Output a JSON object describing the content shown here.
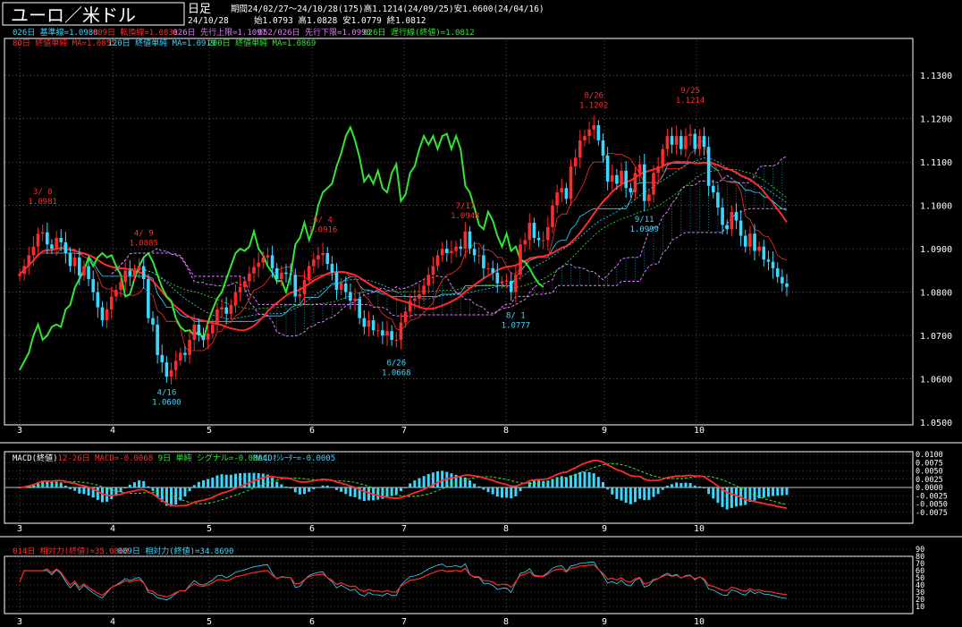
{
  "header": {
    "pair_title": "ユーロ／米ドル",
    "period_label": "日足",
    "period_summary": "期間24/02/27～24/10/28(175)高1.1214(24/09/25)安1.0600(24/04/16)",
    "date": "24/10/28",
    "ohlc": "始1.0793 高1.0828 安1.0779 終1.0812",
    "ichimoku_line1": [
      {
        "text": "026日 基準線=1.0988",
        "color": "#3ad7ff"
      },
      {
        "text": "009日 転換線=1.0831",
        "color": "#ff2a2a"
      },
      {
        "text": "026日 先行上限=1.1097",
        "color": "#e07bff"
      },
      {
        "text": "052/026日 先行下限=1.0990",
        "color": "#e07bff"
      },
      {
        "text": "026日 遅行線(終値)=1.0812",
        "color": "#32e632"
      }
    ],
    "ma_line": [
      {
        "text": "80日 終値単純 MA=1.0855",
        "color": "#ff2a2a"
      },
      {
        "text": "120日 終値単純 MA=1.0919",
        "color": "#3ad7ff"
      },
      {
        "text": "200日 終値単純 MA=1.0869",
        "color": "#32e632"
      }
    ]
  },
  "macd_header": [
    {
      "text": "MACD(終値)",
      "color": "#ffffff"
    },
    {
      "text": "12-26日 MACD=-0.0068",
      "color": "#ff2a2a"
    },
    {
      "text": "9日 単純 シグナル=-0.0064",
      "color": "#32e632"
    },
    {
      "text": "MACDｵｼﾚｰﾀｰ=-0.0005",
      "color": "#3ad7ff"
    }
  ],
  "rsi_header": [
    {
      "text": "014日 相対力(終値)=35.0868",
      "color": "#ff2a2a"
    },
    {
      "text": "009日 相対力(終値)=34.8690",
      "color": "#3ad7ff"
    }
  ],
  "x_ticks": [
    "3",
    "4",
    "5",
    "6",
    "7",
    "8",
    "9",
    "10"
  ],
  "chart_data": [
    {
      "type": "candlestick",
      "ylim": [
        1.05,
        1.135
      ],
      "y_ticks": [
        "1.0500",
        "1.0600",
        "1.0700",
        "1.0800",
        "1.0900",
        "1.1000",
        "1.1100",
        "1.1200",
        "1.1300"
      ],
      "colors": {
        "up": "#ff2a2a",
        "down": "#3ad7ff",
        "ma80": "#ff2a2a",
        "ma120": "#3ad7ff",
        "ma200": "#32e632",
        "cloud": "#e07bff",
        "lagging": "#32e632"
      },
      "annotations": [
        {
          "date": "3/ 8",
          "value": "1.0981",
          "index": 5,
          "price": 1.0981,
          "pos": "above",
          "color": "#ff2a2a"
        },
        {
          "date": "4/ 9",
          "value": "1.0885",
          "index": 27,
          "price": 1.0885,
          "pos": "above",
          "color": "#ff2a2a"
        },
        {
          "date": "4/16",
          "value": "1.0600",
          "index": 32,
          "price": 1.06,
          "pos": "below",
          "color": "#3ad7ff"
        },
        {
          "date": "6/ 4",
          "value": "1.0916",
          "index": 66,
          "price": 1.0916,
          "pos": "above",
          "color": "#ff2a2a"
        },
        {
          "date": "6/26",
          "value": "1.0668",
          "index": 82,
          "price": 1.0668,
          "pos": "below",
          "color": "#3ad7ff"
        },
        {
          "date": "7/17",
          "value": "1.0948",
          "index": 97,
          "price": 1.0948,
          "pos": "above",
          "color": "#ff2a2a"
        },
        {
          "date": "8/ 1",
          "value": "1.0777",
          "index": 108,
          "price": 1.0777,
          "pos": "below",
          "color": "#3ad7ff"
        },
        {
          "date": "8/26",
          "value": "1.1202",
          "index": 125,
          "price": 1.1202,
          "pos": "above",
          "color": "#ff2a2a"
        },
        {
          "date": "9/11",
          "value": "1.0999",
          "index": 136,
          "price": 1.0999,
          "pos": "below",
          "color": "#3ad7ff"
        },
        {
          "date": "9/25",
          "value": "1.1214",
          "index": 146,
          "price": 1.1214,
          "pos": "above",
          "color": "#ff2a2a"
        }
      ],
      "closes": [
        1.0842,
        1.086,
        1.0885,
        1.0905,
        1.0935,
        1.0938,
        1.091,
        1.09,
        1.0925,
        1.0915,
        1.089,
        1.086,
        1.088,
        1.0838,
        1.086,
        1.083,
        1.08,
        1.0765,
        1.0735,
        1.076,
        1.079,
        1.0805,
        1.0823,
        1.085,
        1.0838,
        1.085,
        1.086,
        1.083,
        1.074,
        1.0725,
        1.0655,
        1.0638,
        1.0605,
        1.062,
        1.0642,
        1.066,
        1.0655,
        1.069,
        1.0725,
        1.07,
        1.069,
        1.0705,
        1.0725,
        1.076,
        1.0765,
        1.075,
        1.077,
        1.08,
        1.0812,
        1.0825,
        1.0843,
        1.0858,
        1.0868,
        1.088,
        1.0885,
        1.0855,
        1.083,
        1.0845,
        1.0842,
        1.084,
        1.079,
        1.0795,
        1.0828,
        1.086,
        1.0875,
        1.0885,
        1.089,
        1.0865,
        1.0845,
        1.0805,
        1.082,
        1.08,
        1.078,
        1.0785,
        1.074,
        1.072,
        1.0735,
        1.0712,
        1.0712,
        1.07,
        1.071,
        1.069,
        1.069,
        1.073,
        1.0755,
        1.078,
        1.0785,
        1.0795,
        1.0815,
        1.084,
        1.086,
        1.0885,
        1.09,
        1.089,
        1.0895,
        1.0905,
        1.09,
        1.094,
        1.09,
        1.0885,
        1.0885,
        1.0855,
        1.0855,
        1.0845,
        1.082,
        1.0825,
        1.0826,
        1.08,
        1.084,
        1.091,
        1.092,
        1.096,
        1.0925,
        1.092,
        1.092,
        1.095,
        1.1,
        1.103,
        1.104,
        1.1015,
        1.109,
        1.111,
        1.115,
        1.116,
        1.1175,
        1.1185,
        1.115,
        1.1115,
        1.1055,
        1.107,
        1.105,
        1.108,
        1.104,
        1.103,
        1.1075,
        1.1095,
        1.101,
        1.1025,
        1.1075,
        1.109,
        1.113,
        1.116,
        1.114,
        1.116,
        1.113,
        1.116,
        1.1165,
        1.113,
        1.116,
        1.1135,
        1.1045,
        1.103,
        1.0995,
        1.0955,
        1.0945,
        1.0985,
        1.0965,
        1.093,
        1.0905,
        1.0935,
        1.0895,
        1.0905,
        1.0875,
        1.087,
        1.0855,
        1.0835,
        1.082,
        1.0812
      ],
      "lagging_span": [
        1.062,
        1.064,
        1.066,
        1.07,
        1.0725,
        1.069,
        1.07,
        1.072,
        1.0725,
        1.072,
        1.076,
        1.077,
        1.081,
        1.083,
        1.085,
        1.088,
        1.086,
        1.088,
        1.089,
        1.088,
        1.0885,
        1.086,
        1.084,
        1.079,
        1.0795,
        1.083,
        1.086,
        1.088,
        1.089,
        1.087,
        1.084,
        1.081,
        1.079,
        1.078,
        1.074,
        1.072,
        1.071,
        1.0712,
        1.07,
        1.071,
        1.069,
        1.073,
        1.076,
        1.0785,
        1.08,
        1.083,
        1.086,
        1.089,
        1.09,
        1.0895,
        1.0905,
        1.094,
        1.09,
        1.0885,
        1.086,
        1.0845,
        1.0825,
        1.0826,
        1.08,
        1.084,
        1.091,
        1.0925,
        1.096,
        1.092,
        1.095,
        1.1,
        1.103,
        1.104,
        1.105,
        1.109,
        1.112,
        1.116,
        1.118,
        1.115,
        1.111,
        1.1055,
        1.107,
        1.105,
        1.108,
        1.104,
        1.103,
        1.1075,
        1.1095,
        1.101,
        1.1025,
        1.1075,
        1.109,
        1.113,
        1.116,
        1.114,
        1.116,
        1.113,
        1.116,
        1.1165,
        1.113,
        1.116,
        1.113,
        1.1045,
        1.103,
        1.0995,
        1.0955,
        1.0945,
        1.0985,
        1.0965,
        1.093,
        1.0905,
        1.0935,
        1.0895,
        1.0905,
        1.0875,
        1.087,
        1.0855,
        1.0835,
        1.082,
        1.0812
      ]
    },
    {
      "type": "macd",
      "ylim": [
        -0.01,
        0.01
      ],
      "y_ticks": [
        "0.0100",
        "0.0075",
        "0.0050",
        "0.0025",
        "0.0000",
        "-0.0025",
        "-0.0050",
        "-0.0075"
      ]
    },
    {
      "type": "rsi",
      "ylim": [
        0,
        90
      ],
      "y_ticks": [
        "90",
        "80",
        "70",
        "60",
        "50",
        "40",
        "30",
        "20",
        "10"
      ]
    }
  ]
}
